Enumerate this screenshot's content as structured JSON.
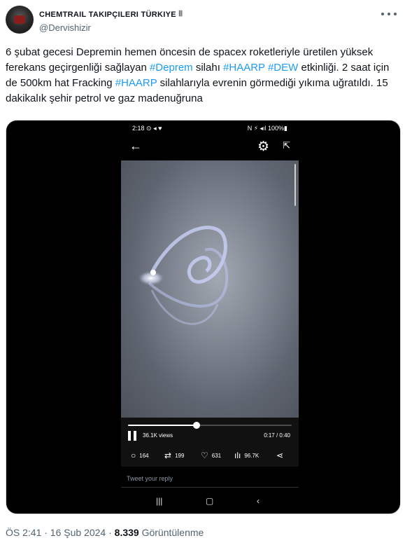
{
  "author": {
    "display_name": "CHEMTRAIL TAKIPÇILERI TÜRKIYE",
    "name_emoji": "𝄃𝄃",
    "handle": "@Dervishizir"
  },
  "tweet": {
    "segments": [
      {
        "text": "6 şubat gecesi Depremin hemen öncesin de spacex roketleriyle üretilen yüksek ferekans geçirgenliği sağlayan ",
        "tag": false
      },
      {
        "text": "#Deprem",
        "tag": true
      },
      {
        "text": " silahı ",
        "tag": false
      },
      {
        "text": "#HAARP",
        "tag": true
      },
      {
        "text": " ",
        "tag": false
      },
      {
        "text": "#DEW",
        "tag": true
      },
      {
        "text": " etkinliği. 2 saat için de 500km hat Fracking ",
        "tag": false
      },
      {
        "text": "#HAARP",
        "tag": true
      },
      {
        "text": " silahlarıyla evrenin görmediği yıkıma uğratıldı. 15 dakikalık şehir petrol ve gaz madenuğruna",
        "tag": false
      }
    ]
  },
  "phone": {
    "status_time": "2:18",
    "status_icons_left": "⊙ ◂ ♥",
    "status_right": "N ⚡ ◂ıl 100%▮",
    "video": {
      "views": "36.1K views",
      "time": "0:17 / 0:40",
      "progress": 0.42
    },
    "actions": {
      "replies": "164",
      "retweets": "199",
      "likes": "631",
      "views": "96.7K"
    },
    "reply_placeholder": "Tweet your reply"
  },
  "meta": {
    "time_date": "ÖS 2:41 · 16 Şub 2024 · ",
    "views_count": "8.339",
    "views_label": " Görüntülenme"
  },
  "icons": {
    "more": "more-dots-icon",
    "back": "back-arrow-icon",
    "gear": "gear-icon",
    "share": "share-icon"
  },
  "colors": {
    "hashtag": "#1d9bf0",
    "secondary_text": "#536471",
    "primary_text": "#0f1419"
  }
}
